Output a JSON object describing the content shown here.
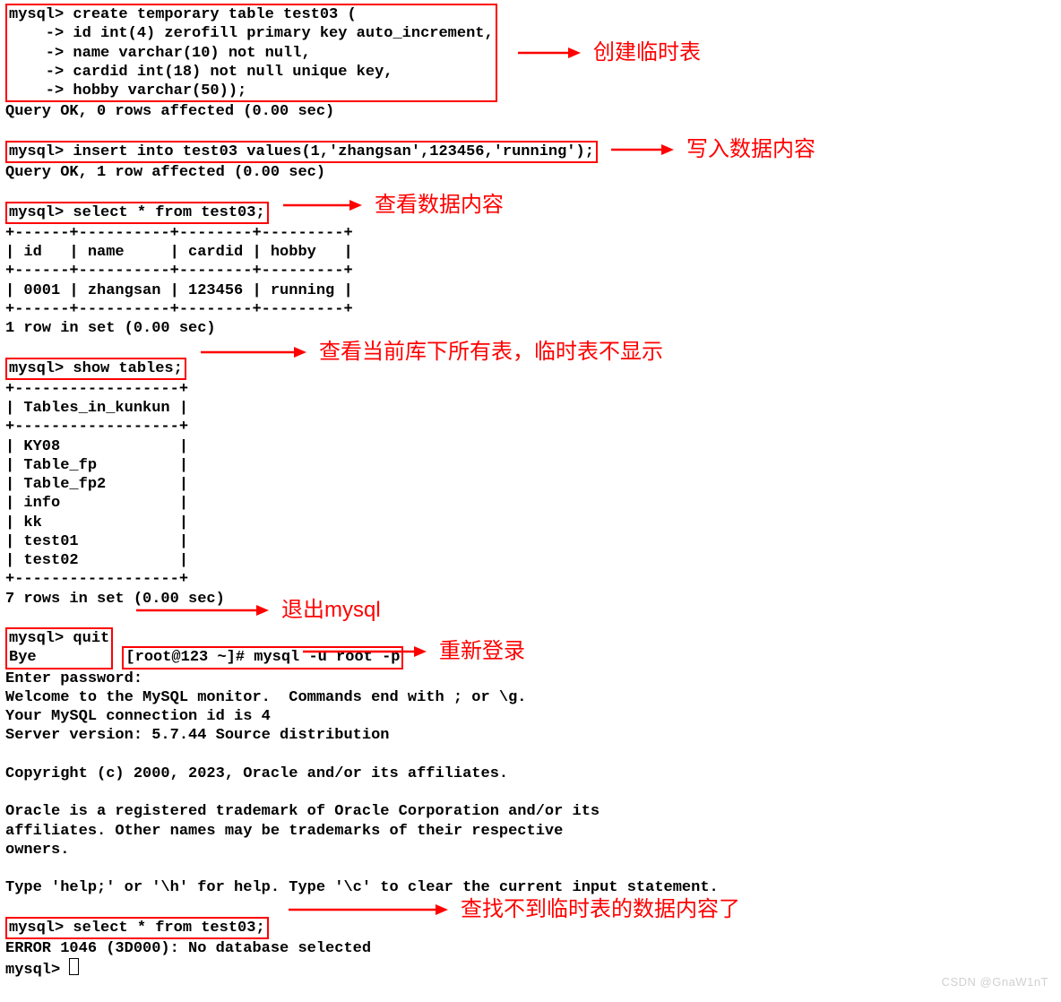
{
  "terminal": {
    "block_create": "mysql> create temporary table test03 (\n    -> id int(4) zerofill primary key auto_increment,\n    -> name varchar(10) not null,\n    -> cardid int(18) not null unique key,\n    -> hobby varchar(50));",
    "line_create_ok": "Query OK, 0 rows affected (0.00 sec)",
    "block_insert": "mysql> insert into test03 values(1,'zhangsan',123456,'running');",
    "line_insert_ok": "Query OK, 1 row affected (0.00 sec)",
    "block_select1": "mysql> select * from test03;",
    "block_select1_result": "+------+----------+--------+---------+\n| id   | name     | cardid | hobby   |\n+------+----------+--------+---------+\n| 0001 | zhangsan | 123456 | running |\n+------+----------+--------+---------+\n1 row in set (0.00 sec)",
    "block_show_tables": "mysql> show tables;",
    "block_show_tables_result": "+------------------+\n| Tables_in_kunkun |\n+------------------+\n| KY08             |\n| Table_fp         |\n| Table_fp2        |\n| info             |\n| kk               |\n| test01           |\n| test02           |\n+------------------+\n7 rows in set (0.00 sec)",
    "block_quit": "mysql> quit\nBye",
    "block_relogin": "[root@123 ~]# mysql -u root -p",
    "block_relogin_after": "Enter password:\nWelcome to the MySQL monitor.  Commands end with ; or \\g.\nYour MySQL connection id is 4\nServer version: 5.7.44 Source distribution\n\nCopyright (c) 2000, 2023, Oracle and/or its affiliates.\n\nOracle is a registered trademark of Oracle Corporation and/or its\naffiliates. Other names may be trademarks of their respective\nowners.\n\nType 'help;' or '\\h' for help. Type '\\c' to clear the current input statement.",
    "block_select2": "mysql> select * from test03;",
    "line_error": "ERROR 1046 (3D000): No database selected",
    "line_prompt": "mysql> "
  },
  "annotations": {
    "create_table": "创建临时表",
    "insert_data": "写入数据内容",
    "select_data": "查看数据内容",
    "show_tables": "查看当前库下所有表，临时表不显示",
    "quit": "退出mysql",
    "relogin": "重新登录",
    "select_again": "查找不到临时表的数据内容了"
  },
  "watermark": "CSDN @GnaW1nT"
}
